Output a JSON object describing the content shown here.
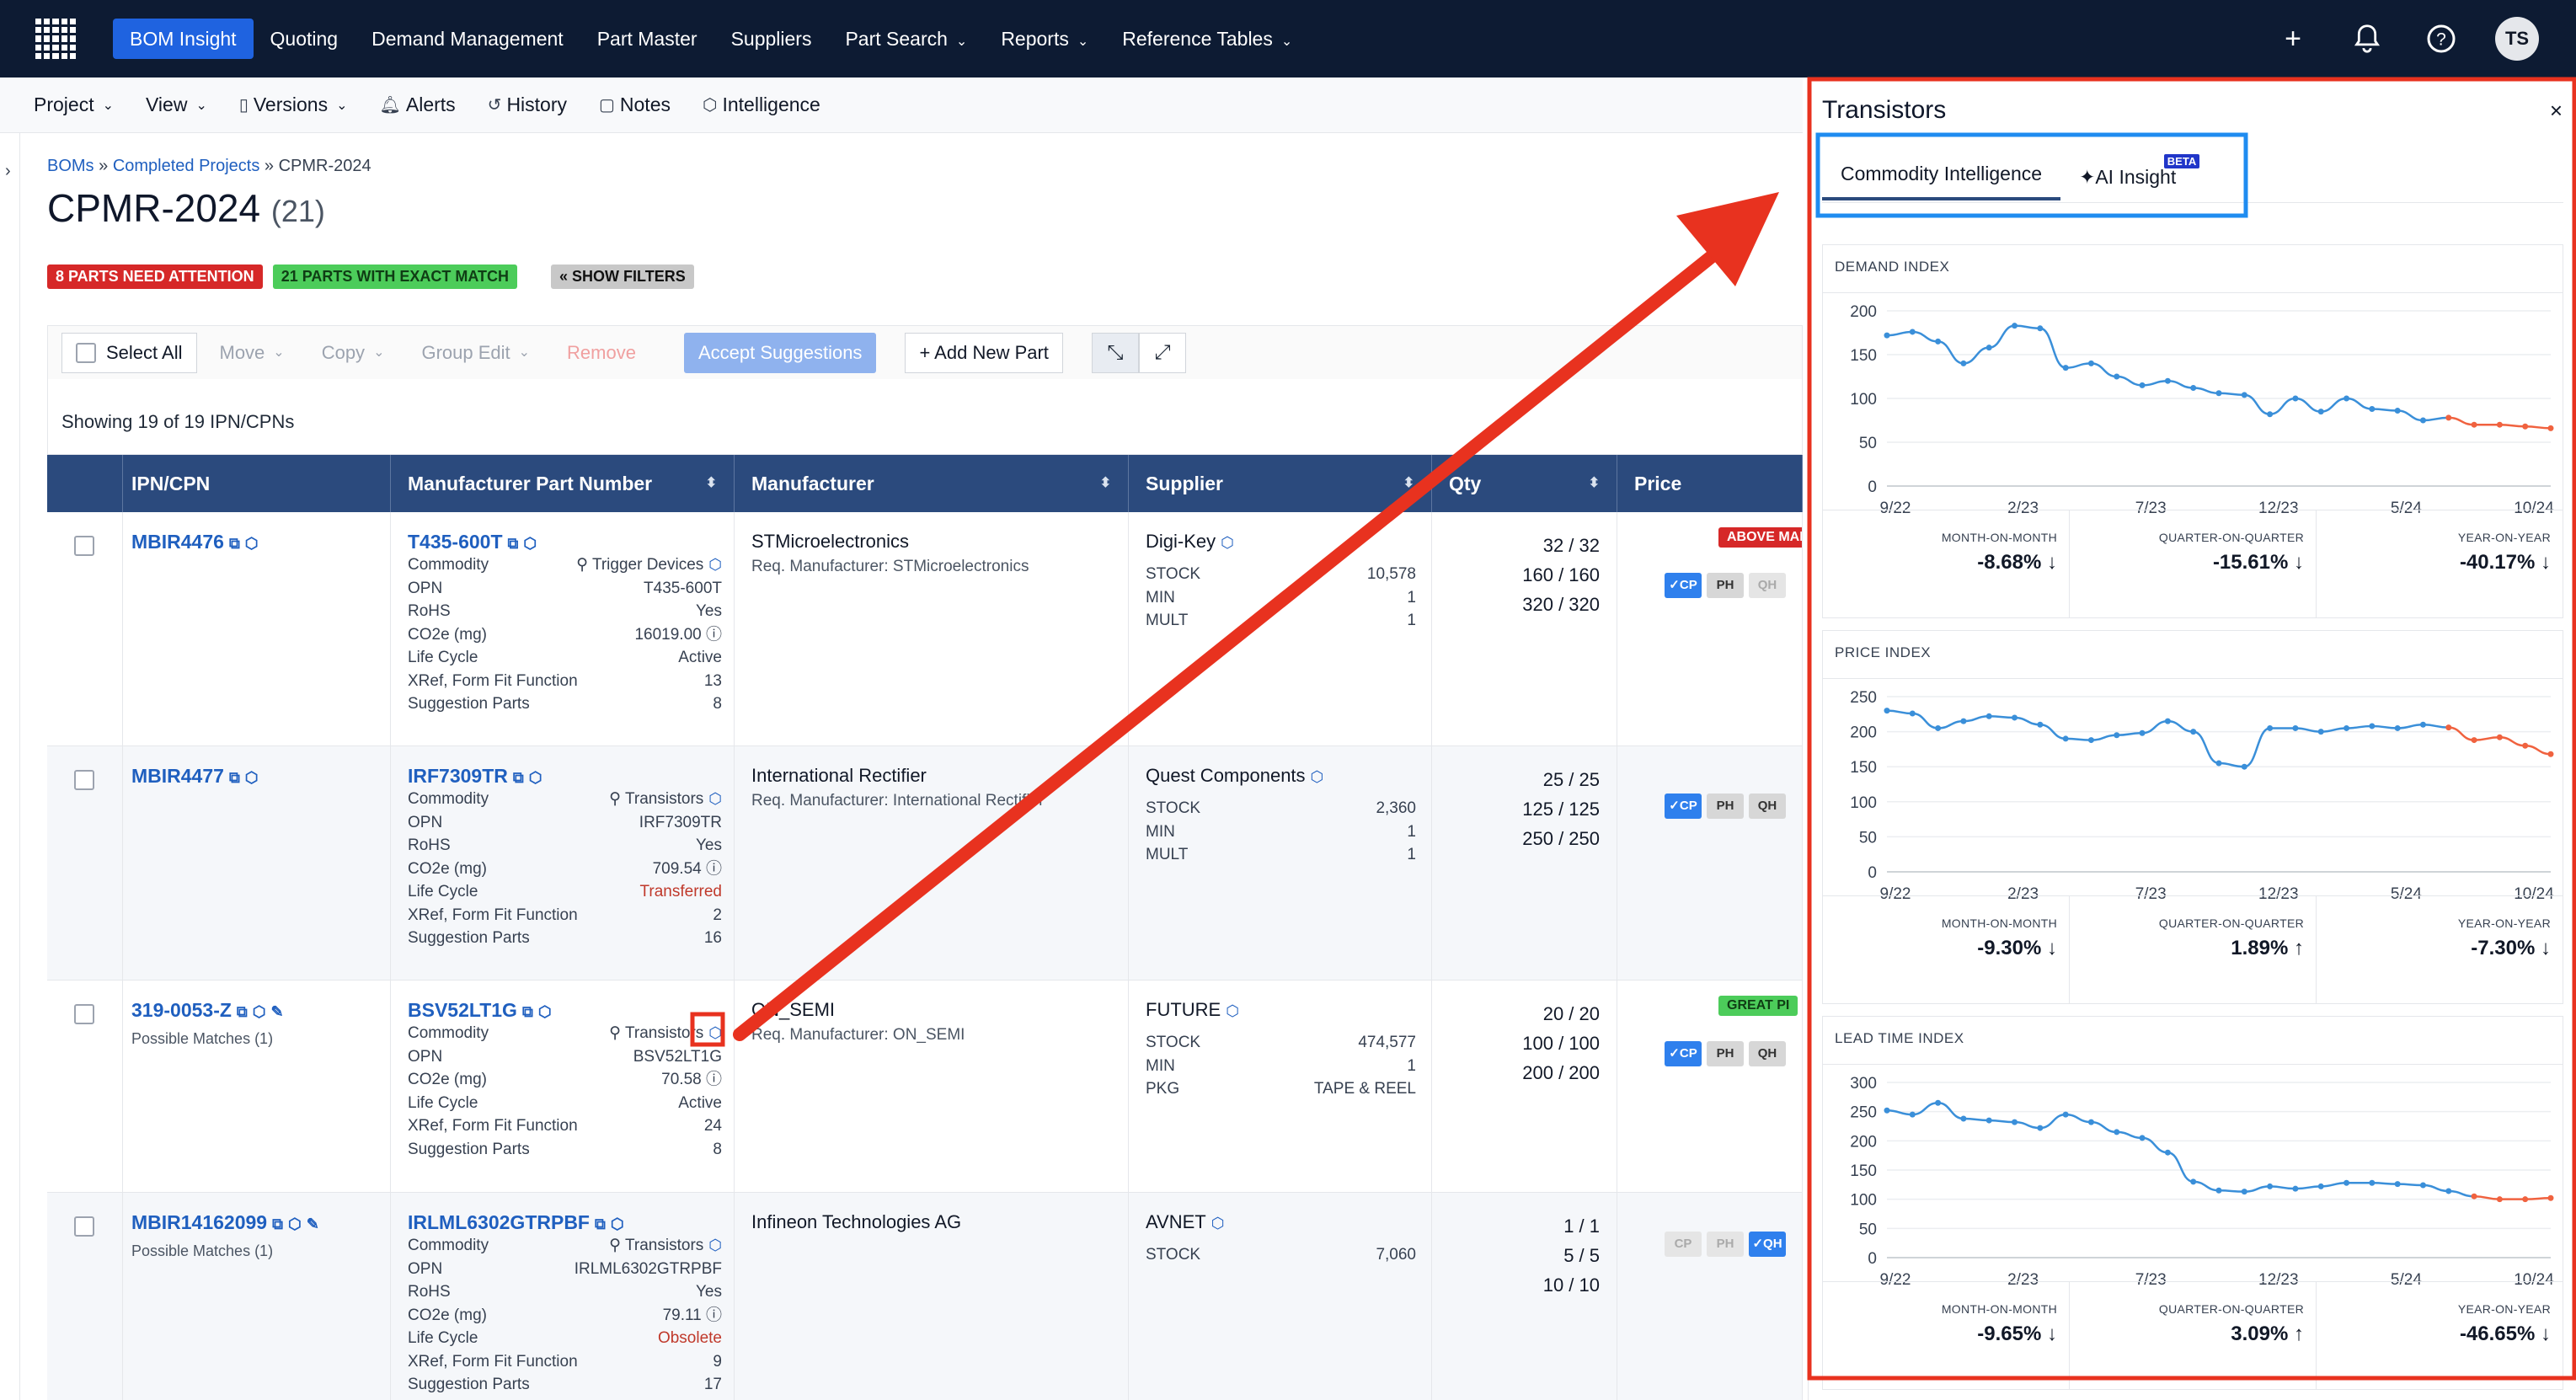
{
  "nav": {
    "items": [
      {
        "label": "BOM Insight",
        "active": true,
        "dropdown": false
      },
      {
        "label": "Quoting",
        "active": false,
        "dropdown": false
      },
      {
        "label": "Demand Management",
        "active": false,
        "dropdown": false
      },
      {
        "label": "Part Master",
        "active": false,
        "dropdown": false
      },
      {
        "label": "Suppliers",
        "active": false,
        "dropdown": false
      },
      {
        "label": "Part Search",
        "active": false,
        "dropdown": true
      },
      {
        "label": "Reports",
        "active": false,
        "dropdown": true
      },
      {
        "label": "Reference Tables",
        "active": false,
        "dropdown": true
      }
    ],
    "avatar_initials": "TS",
    "icons": [
      "plus-icon",
      "bell-icon",
      "help-icon"
    ]
  },
  "subbar": {
    "project": "Project",
    "view": "View",
    "versions": "Versions",
    "alerts": "Alerts",
    "history": "History",
    "notes": "Notes",
    "intelligence": "Intelligence"
  },
  "breadcrumb": {
    "boms": "BOMs",
    "sep": "»",
    "completed": "Completed Projects",
    "current": "CPMR-2024"
  },
  "page": {
    "title": "CPMR-2024",
    "count": "(21)"
  },
  "badges": {
    "attention": "8 PARTS NEED ATTENTION",
    "exact": "21 PARTS WITH EXACT MATCH",
    "filters": "« SHOW FILTERS"
  },
  "toolbar": {
    "select_all": "Select All",
    "move": "Move",
    "copy": "Copy",
    "group_edit": "Group Edit",
    "remove": "Remove",
    "accept": "Accept Suggestions",
    "add_part": "+ Add New Part"
  },
  "showing": "Showing 19 of 19 IPN/CPNs",
  "table": {
    "headers": [
      "IPN/CPN",
      "Manufacturer Part Number",
      "Manufacturer",
      "Supplier",
      "Qty",
      "Price"
    ],
    "rows": [
      {
        "ipn": "MBIR4476",
        "possible": "",
        "mpn": "T435-600T",
        "attrs": [
          [
            "Commodity",
            "Trigger Devices"
          ],
          [
            "OPN",
            "T435-600T"
          ],
          [
            "RoHS",
            "Yes"
          ],
          [
            "CO2e (mg)",
            "16019.00"
          ],
          [
            "Life Cycle",
            "Active"
          ],
          [
            "XRef, Form Fit Function",
            "13"
          ],
          [
            "Suggestion Parts",
            "8"
          ]
        ],
        "lifecycle_status": "ok",
        "manufacturer": "STMicroelectronics",
        "req_mfr": "Req. Manufacturer: STMicroelectronics",
        "supplier": "Digi-Key",
        "supplier_attrs": [
          [
            "STOCK",
            "10,578"
          ],
          [
            "MIN",
            "1"
          ],
          [
            "MULT",
            "1"
          ]
        ],
        "qty": [
          "32 / 32",
          "160 / 160",
          "320 / 320"
        ],
        "price_badge": "ABOVE MAR",
        "price_badge_color": "#d62828",
        "chips": [
          [
            "✓CP",
            "on"
          ],
          [
            "PH",
            "plain"
          ],
          [
            "QH",
            "off"
          ]
        ]
      },
      {
        "ipn": "MBIR4477",
        "possible": "",
        "mpn": "IRF7309TR",
        "attrs": [
          [
            "Commodity",
            "Transistors"
          ],
          [
            "OPN",
            "IRF7309TR"
          ],
          [
            "RoHS",
            "Yes"
          ],
          [
            "CO2e (mg)",
            "709.54"
          ],
          [
            "Life Cycle",
            "Transferred"
          ],
          [
            "XRef, Form Fit Function",
            "2"
          ],
          [
            "Suggestion Parts",
            "16"
          ]
        ],
        "lifecycle_status": "red",
        "manufacturer": "International Rectifier",
        "req_mfr": "Req. Manufacturer: International Rectifier",
        "supplier": "Quest Components",
        "supplier_attrs": [
          [
            "STOCK",
            "2,360"
          ],
          [
            "MIN",
            "1"
          ],
          [
            "MULT",
            "1"
          ]
        ],
        "qty": [
          "25 / 25",
          "125 / 125",
          "250 / 250"
        ],
        "price_badge": "",
        "price_badge_color": "",
        "chips": [
          [
            "✓CP",
            "on"
          ],
          [
            "PH",
            "plain"
          ],
          [
            "QH",
            "plain"
          ]
        ]
      },
      {
        "ipn": "319-0053-Z",
        "possible": "Possible Matches (1)",
        "mpn": "BSV52LT1G",
        "attrs": [
          [
            "Commodity",
            "Transistors"
          ],
          [
            "OPN",
            "BSV52LT1G"
          ],
          [
            "CO2e (mg)",
            "70.58"
          ],
          [
            "Life Cycle",
            "Active"
          ],
          [
            "XRef, Form Fit Function",
            "24"
          ],
          [
            "Suggestion Parts",
            "8"
          ]
        ],
        "lifecycle_status": "ok",
        "manufacturer": "ON_SEMI",
        "req_mfr": "Req. Manufacturer: ON_SEMI",
        "supplier": "FUTURE",
        "supplier_attrs": [
          [
            "STOCK",
            "474,577"
          ],
          [
            "MIN",
            "1"
          ],
          [
            "PKG",
            "TAPE & REEL"
          ]
        ],
        "qty": [
          "20 / 20",
          "100 / 100",
          "200 / 200"
        ],
        "price_badge": "GREAT PI",
        "price_badge_color": "#4ccc5a",
        "chips": [
          [
            "✓CP",
            "on"
          ],
          [
            "PH",
            "plain"
          ],
          [
            "QH",
            "plain"
          ]
        ]
      },
      {
        "ipn": "MBIR14162099",
        "possible": "Possible Matches (1)",
        "mpn": "IRLML6302GTRPBF",
        "attrs": [
          [
            "Commodity",
            "Transistors"
          ],
          [
            "OPN",
            "IRLML6302GTRPBF"
          ],
          [
            "RoHS",
            "Yes"
          ],
          [
            "CO2e (mg)",
            "79.11"
          ],
          [
            "Life Cycle",
            "Obsolete"
          ],
          [
            "XRef, Form Fit Function",
            "9"
          ],
          [
            "Suggestion Parts",
            "17"
          ]
        ],
        "lifecycle_status": "red",
        "manufacturer": "Infineon Technologies AG",
        "req_mfr": "",
        "supplier": "AVNET",
        "supplier_attrs": [
          [
            "STOCK",
            "7,060"
          ]
        ],
        "qty": [
          "1 / 1",
          "5 / 5",
          "10 / 10"
        ],
        "price_badge": "",
        "price_badge_color": "",
        "chips": [
          [
            "CP",
            "off"
          ],
          [
            "PH",
            "off"
          ],
          [
            "✓QH",
            "on"
          ]
        ]
      }
    ]
  },
  "panel": {
    "title": "Transistors",
    "close": "×",
    "tabs": [
      {
        "label": "Commodity Intelligence",
        "active": true
      },
      {
        "label": "AI Insight",
        "active": false,
        "beta": "BETA"
      }
    ],
    "cards": [
      {
        "title": "DEMAND INDEX",
        "chart_data": {
          "type": "line",
          "x_ticks": [
            "9/22",
            "2/23",
            "7/23",
            "12/23",
            "5/24",
            "10/24"
          ],
          "y_ticks": [
            0,
            50,
            100,
            150,
            200
          ],
          "ylim": [
            0,
            200
          ],
          "series": [
            {
              "values": [
                172,
                176,
                165,
                140,
                158,
                183,
                180,
                135,
                140,
                125,
                115,
                120,
                112,
                106,
                104,
                82,
                100,
                85,
                100,
                88,
                86,
                75,
                78,
                70,
                70,
                68,
                66
              ],
              "forecast_from": 22
            }
          ],
          "actual_color": "#3a8fd9",
          "forecast_color": "#f0623f"
        },
        "stats": [
          [
            "MONTH-ON-MONTH",
            "-8.68%",
            "down"
          ],
          [
            "QUARTER-ON-QUARTER",
            "-15.61%",
            "down"
          ],
          [
            "YEAR-ON-YEAR",
            "-40.17%",
            "down"
          ]
        ]
      },
      {
        "title": "PRICE INDEX",
        "chart_data": {
          "type": "line",
          "x_ticks": [
            "9/22",
            "2/23",
            "7/23",
            "12/23",
            "5/24",
            "10/24"
          ],
          "y_ticks": [
            0,
            50,
            100,
            150,
            200,
            250
          ],
          "ylim": [
            0,
            250
          ],
          "series": [
            {
              "values": [
                230,
                226,
                205,
                215,
                222,
                220,
                210,
                190,
                188,
                195,
                198,
                215,
                200,
                155,
                150,
                205,
                205,
                200,
                205,
                208,
                205,
                210,
                206,
                188,
                192,
                180,
                168
              ],
              "forecast_from": 22
            }
          ],
          "actual_color": "#3a8fd9",
          "forecast_color": "#f0623f"
        },
        "stats": [
          [
            "MONTH-ON-MONTH",
            "-9.30%",
            "down"
          ],
          [
            "QUARTER-ON-QUARTER",
            "1.89%",
            "up"
          ],
          [
            "YEAR-ON-YEAR",
            "-7.30%",
            "down"
          ]
        ]
      },
      {
        "title": "LEAD TIME INDEX",
        "chart_data": {
          "type": "line",
          "x_ticks": [
            "9/22",
            "2/23",
            "7/23",
            "12/23",
            "5/24",
            "10/24"
          ],
          "y_ticks": [
            0,
            50,
            100,
            150,
            200,
            250,
            300
          ],
          "ylim": [
            0,
            300
          ],
          "series": [
            {
              "values": [
                252,
                245,
                265,
                238,
                235,
                232,
                222,
                245,
                232,
                215,
                205,
                180,
                130,
                115,
                113,
                122,
                118,
                122,
                128,
                128,
                126,
                124,
                114,
                105,
                100,
                100,
                102
              ],
              "forecast_from": 23
            }
          ],
          "actual_color": "#3a8fd9",
          "forecast_color": "#f0623f"
        },
        "stats": [
          [
            "MONTH-ON-MONTH",
            "-9.65%",
            "down"
          ],
          [
            "QUARTER-ON-QUARTER",
            "3.09%",
            "up"
          ],
          [
            "YEAR-ON-YEAR",
            "-46.65%",
            "down"
          ]
        ]
      }
    ]
  },
  "annotation": {
    "color": "#e8321f",
    "tabs_box_color": "#1f8cf0"
  }
}
